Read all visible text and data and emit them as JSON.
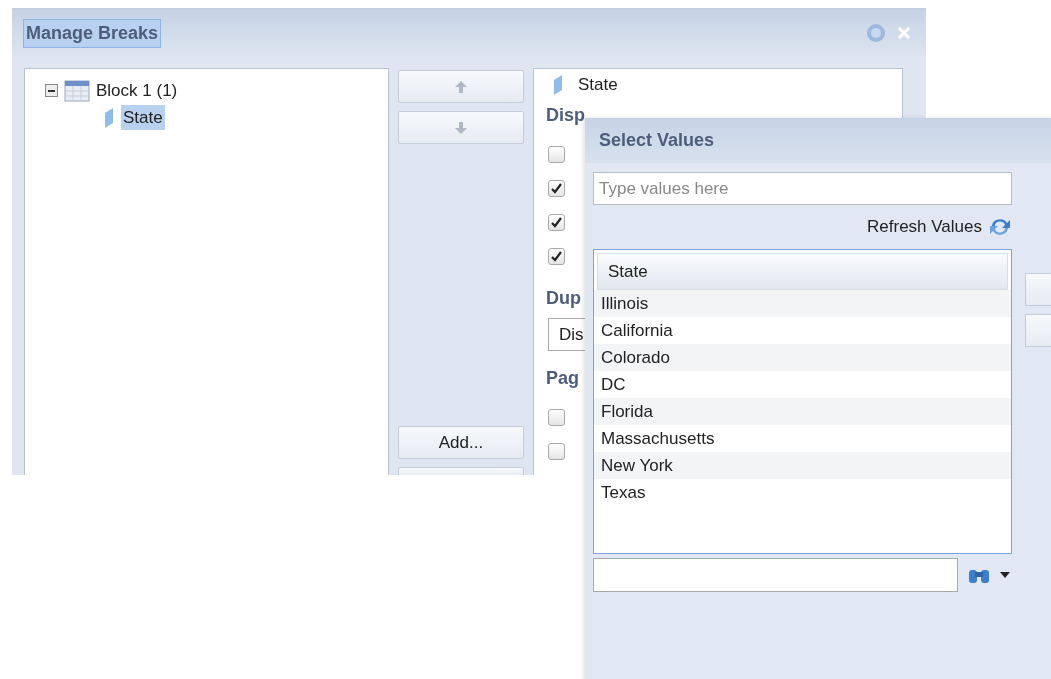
{
  "manage_breaks": {
    "title": "Manage Breaks",
    "tree": [
      {
        "label": "Block 1 (1)",
        "expanded": true,
        "children": [
          {
            "label": "State",
            "selected": true
          }
        ]
      }
    ],
    "buttons": [
      {
        "kind": "up"
      },
      {
        "kind": "down"
      },
      {
        "kind": "text",
        "label": "Add..."
      }
    ],
    "break_object": "State",
    "display_properties": {
      "heading": "Disp",
      "checkboxes": [
        {
          "checked": false
        },
        {
          "checked": true
        },
        {
          "checked": true
        },
        {
          "checked": true
        }
      ]
    },
    "duplicates": {
      "heading": "Dup",
      "dropdown_value": "Dis"
    },
    "page": {
      "heading": "Pag",
      "checkboxes": [
        {
          "checked": false
        },
        {
          "checked": false
        }
      ]
    }
  },
  "select_values": {
    "title": "Select Values",
    "input": {
      "placeholder": "Type values here"
    },
    "refresh_label": "Refresh Values",
    "list": {
      "column": "State",
      "rows": [
        "Illinois",
        "California",
        "Colorado",
        "DC",
        "Florida",
        "Massachusetts",
        "New York",
        "Texas"
      ]
    }
  }
}
